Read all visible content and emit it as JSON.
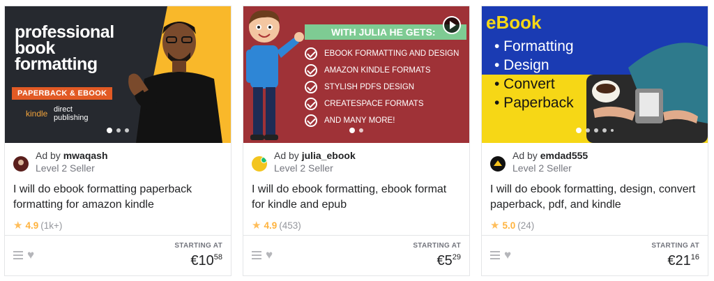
{
  "gigs": [
    {
      "thumb": {
        "title_lines": [
          "professional",
          "book",
          "formatting"
        ],
        "banner": "PAPERBACK & EBOOK",
        "kdp_brand": "kindle",
        "kdp_text_1": "direct",
        "kdp_text_2": "publishing"
      },
      "ad_prefix": "Ad by",
      "seller": "mwaqash",
      "level": "Level 2 Seller",
      "title": "I will do ebook formatting paperback formatting for amazon kindle",
      "rating": "4.9",
      "reviews": "(1k+)",
      "starting_label": "STARTING AT",
      "price_main": "€10",
      "price_cents": "58"
    },
    {
      "thumb": {
        "header": "WITH JULIA HE GETS:",
        "items": [
          "EBOOK FORMATTING AND DESIGN",
          "AMAZON KINDLE FORMATS",
          "STYLISH PDFS DESIGN",
          "CREATESPACE FORMATS",
          "AND MANY MORE!"
        ]
      },
      "ad_prefix": "Ad by",
      "seller": "julia_ebook",
      "level": "Level 2 Seller",
      "title": "I will do ebook formatting, ebook format for kindle and epub",
      "rating": "4.9",
      "reviews": "(453)",
      "starting_label": "STARTING AT",
      "price_main": "€5",
      "price_cents": "29"
    },
    {
      "thumb": {
        "title": "eBook",
        "items": [
          "• Formatting",
          "• Design",
          "• Convert",
          "• Paperback"
        ]
      },
      "ad_prefix": "Ad by",
      "seller": "emdad555",
      "level": "Level 2 Seller",
      "title": "I will do ebook formatting, design, convert paperback, pdf, and kindle",
      "rating": "5.0",
      "reviews": "(24)",
      "starting_label": "STARTING AT",
      "price_main": "€21",
      "price_cents": "16"
    }
  ],
  "icons": {
    "star": "star-icon",
    "heart": "heart-icon",
    "menu": "menu-icon",
    "play": "play-icon",
    "check": "check-icon"
  },
  "colors": {
    "rating": "#ffbe5b",
    "border": "#e4e5e7",
    "thumb1_bg": "#26292f",
    "thumb1_accent": "#f9b82a",
    "thumb2_bg": "#9f3237",
    "thumb3_blue": "#1a3bb3",
    "thumb3_yellow": "#f6d716"
  }
}
